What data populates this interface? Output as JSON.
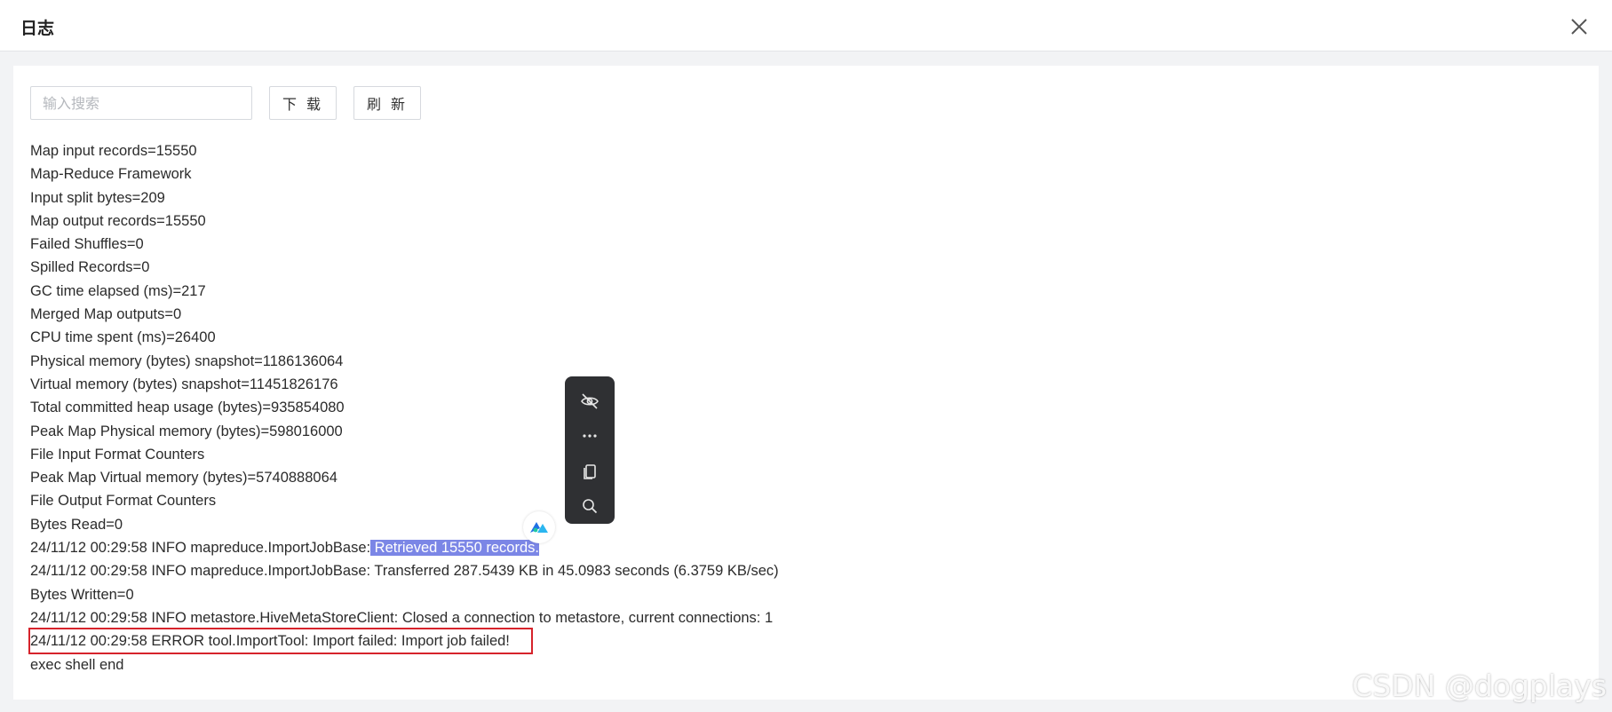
{
  "dialog": {
    "title": "日志",
    "close_icon": "close-icon"
  },
  "toolbar": {
    "search_placeholder": "输入搜索",
    "download_label": "下 载",
    "refresh_label": "刷 新"
  },
  "log_lines": [
    "Map input records=15550",
    "Map-Reduce Framework",
    "Input split bytes=209",
    "Map output records=15550",
    "Failed Shuffles=0",
    "Spilled Records=0",
    "GC time elapsed (ms)=217",
    "Merged Map outputs=0",
    "CPU time spent (ms)=26400",
    "Physical memory (bytes) snapshot=1186136064",
    "Virtual memory (bytes) snapshot=11451826176",
    "Total committed heap usage (bytes)=935854080",
    "Peak Map Physical memory (bytes)=598016000",
    "File Input Format Counters",
    "Peak Map Virtual memory (bytes)=5740888064",
    "File Output Format Counters",
    "Bytes Read=0"
  ],
  "retrieved_line": {
    "prefix": "24/11/12 00:29:58 INFO mapreduce.ImportJobBase:",
    "highlighted": " Retrieved 15550 records."
  },
  "log_lines_after": [
    "24/11/12 00:29:58 INFO mapreduce.ImportJobBase: Transferred 287.5439 KB in 45.0983 seconds (6.3759 KB/sec)",
    "Bytes Written=0",
    "24/11/12 00:29:58 INFO metastore.HiveMetaStoreClient: Closed a connection to metastore, current connections: 1"
  ],
  "error_line": "24/11/12 00:29:58 ERROR tool.ImportTool: Import failed: Import job failed!",
  "last_line": "exec shell end",
  "floating_toolbar": {
    "items": [
      "eye-off-icon",
      "more-icon",
      "copy-icon",
      "search-icon"
    ]
  },
  "watermark": "CSDN @dogplays",
  "colors": {
    "selection": "#7b86e6",
    "error_box": "#d6232b"
  }
}
